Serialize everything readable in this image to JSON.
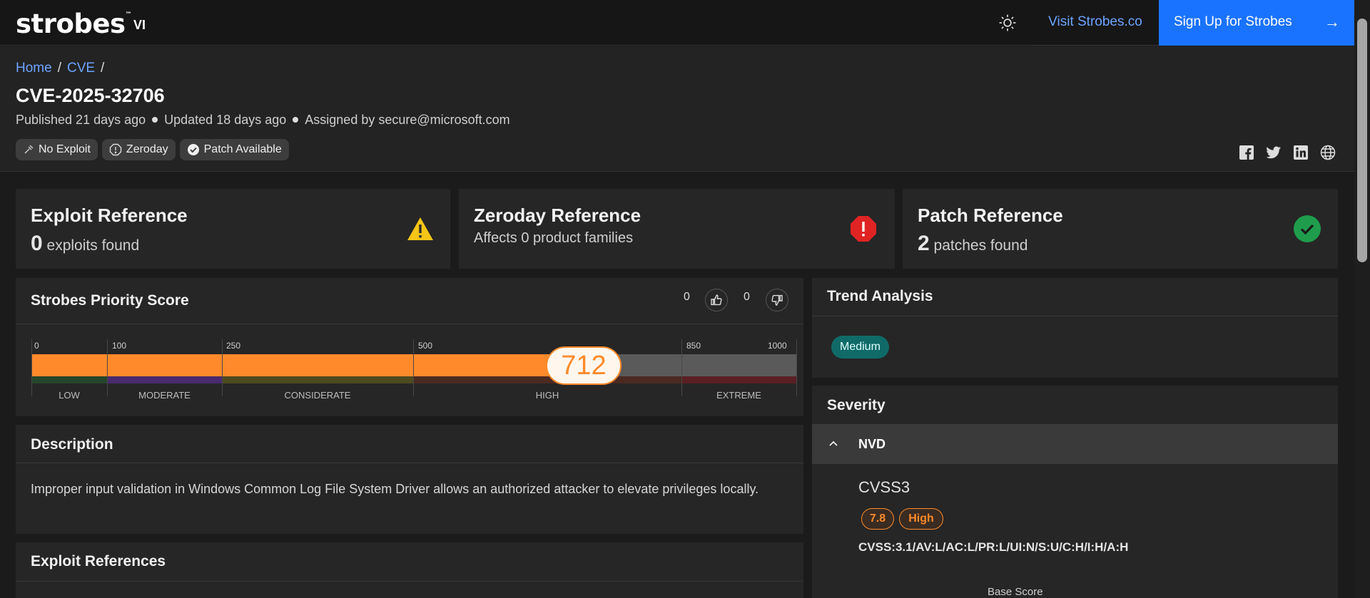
{
  "header": {
    "logo_text": "strobes",
    "logo_tm": "™",
    "logo_suffix": "VI",
    "visit_label": "Visit Strobes.co",
    "signup_label": "Sign Up for Strobes",
    "signup_arrow": "→"
  },
  "breadcrumb": [
    {
      "label": "Home"
    },
    {
      "label": "CVE"
    }
  ],
  "cve": {
    "id": "CVE-2025-32706",
    "published": "Published 21 days ago",
    "updated": "Updated 18 days ago",
    "assigned": "Assigned by secure@microsoft.com"
  },
  "tags": [
    {
      "label": "No Exploit",
      "icon": "no-exploit-icon"
    },
    {
      "label": "Zeroday",
      "icon": "zeroday-icon"
    },
    {
      "label": "Patch Available",
      "icon": "check-circle-icon"
    }
  ],
  "references": {
    "exploit": {
      "title": "Exploit Reference",
      "count": "0",
      "suffix": "exploits found",
      "color": "#f5c518"
    },
    "zeroday": {
      "title": "Zeroday Reference",
      "subtitle": "Affects 0 product families",
      "color": "#e02424"
    },
    "patch": {
      "title": "Patch Reference",
      "count": "2",
      "suffix": "patches found",
      "color": "#1f9d4c"
    }
  },
  "priority": {
    "title": "Strobes Priority Score",
    "upvotes": "0",
    "downvotes": "0",
    "score": "712",
    "score_value": 712,
    "max": 1000,
    "scale_ticks": [
      "0",
      "100",
      "250",
      "500",
      "850",
      "1000"
    ],
    "ranges": [
      "LOW",
      "MODERATE",
      "CONSIDERATE",
      "HIGH",
      "EXTREME"
    ],
    "fill_color": "#ff8a2b"
  },
  "description": {
    "title": "Description",
    "text": "Improper input validation in Windows Common Log File System Driver allows an authorized attacker to elevate privileges locally."
  },
  "exploit_refs": {
    "title": "Exploit References"
  },
  "trend": {
    "title": "Trend Analysis",
    "level": "Medium"
  },
  "severity": {
    "title": "Severity",
    "source": "NVD",
    "cvss_title": "CVSS3",
    "score": "7.8",
    "level": "High",
    "vector": "CVSS:3.1/AV:L/AC:L/PR:L/UI:N/S:U/C:H/I:H/A:H",
    "base_score_label": "Base Score"
  }
}
